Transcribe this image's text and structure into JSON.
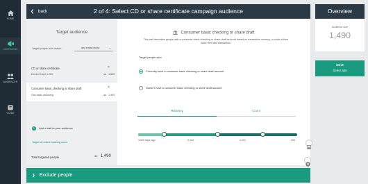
{
  "nav": {
    "items": [
      {
        "label": "HOME",
        "icon": "home-icon"
      },
      {
        "label": "CAMPAIGNS",
        "icon": "campaigns-icon",
        "active": true
      },
      {
        "label": "AUDIENCES",
        "icon": "audiences-icon"
      },
      {
        "label": "GUIDE",
        "icon": "guide-icon"
      }
    ]
  },
  "header": {
    "back_label": "back",
    "title": "2 of 4: Select CD or share certificate campaign audience"
  },
  "audience": {
    "title": "Target audience",
    "match_label": "Target people who match",
    "match_value": "any traits below",
    "traits": [
      {
        "name": "CD or share certificate",
        "detail": "Doesn't have a CD",
        "count": "1,635"
      },
      {
        "name": "Consumer basic checking or share draft",
        "detail": "Has basic checking",
        "count": "1,490"
      }
    ],
    "add_trait_label": "Add a trait to your audience",
    "target_all_label": "Target all online banking users",
    "total_label": "Total targeted people",
    "total_value": "1,490"
  },
  "detail": {
    "title": "Consumer basic checking or share draft",
    "description": "This trait describes people with a consumer basic checking or share draft account based on transaction recency, or units of time since their last transaction.",
    "target_who_label": "Target people who",
    "options": [
      {
        "label": "Currently have a consumer basic checking or share draft account",
        "selected": true
      },
      {
        "label": "Doesn't have a consumer basic checking or share draft account",
        "selected": false
      }
    ],
    "tabs": [
      {
        "label": "Recency",
        "active": true
      },
      {
        "label": "Count",
        "active": false
      }
    ],
    "slider_ticks": [
      "3,023 days ago",
      "2,132",
      "1,221",
      "330"
    ]
  },
  "exclude_label": "Exclude people",
  "overview": {
    "title": "Overview",
    "size_label": "Audience size",
    "size_value": "1,490",
    "next_title": "Next",
    "next_sub": "Select ads"
  },
  "colors": {
    "accent": "#1a9b7f",
    "header_bg": "#2c3a45",
    "nav_bg": "#1f2b35"
  }
}
